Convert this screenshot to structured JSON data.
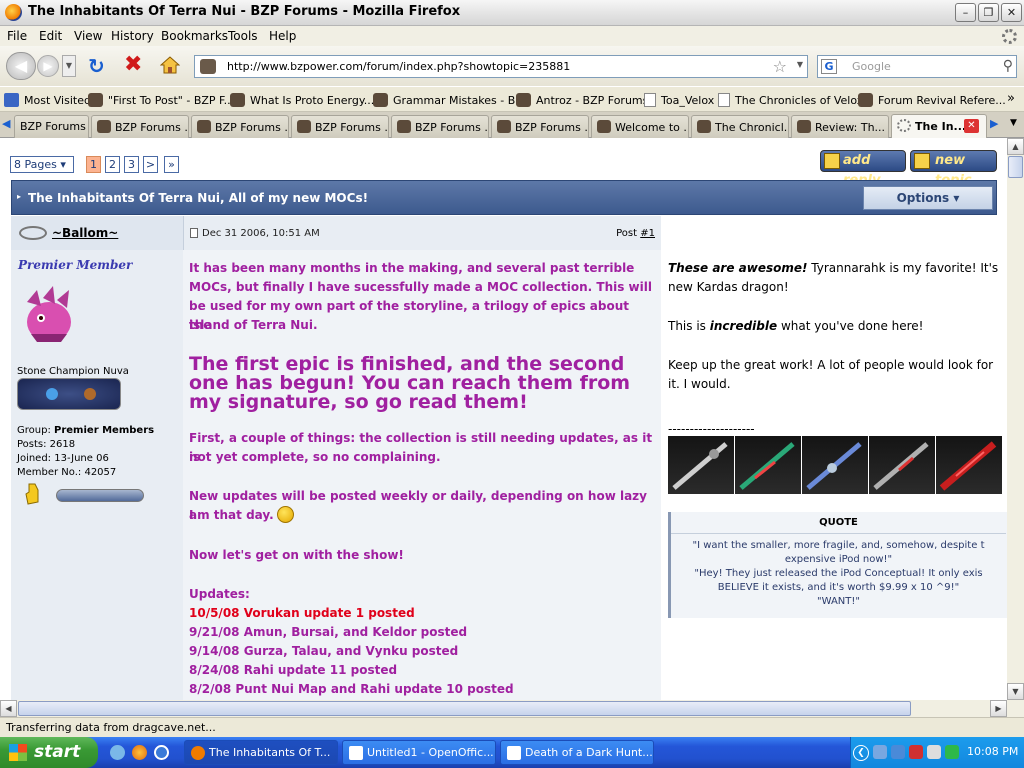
{
  "window": {
    "title": "The Inhabitants Of Terra Nui - BZP Forums - Mozilla Firefox"
  },
  "menu": [
    "File",
    "Edit",
    "View",
    "History",
    "Bookmarks",
    "Tools",
    "Help"
  ],
  "nav": {
    "url": "http://www.bzpower.com/forum/index.php?showtopic=235881",
    "search_placeholder": "Google"
  },
  "bookmarks": [
    "Most Visited",
    "\"First To Post\" - BZP F...",
    "What Is Proto Energy...",
    "Grammar Mistakes - B...",
    "Antroz - BZP Forums",
    "Toa_Velox",
    "The Chronicles of Velox",
    "Forum Revival Refere..."
  ],
  "tabs": [
    "BZP Forums ...",
    "BZP Forums ...",
    "BZP Forums ...",
    "BZP Forums ...",
    "BZP Forums ...",
    "BZP Forums ...",
    "Welcome to ...",
    "The Chronicl...",
    "Review: Th...",
    "The In..."
  ],
  "forum": {
    "pages_label": "8 Pages",
    "page_numbers": [
      "1",
      "2",
      "3",
      ">",
      "»"
    ],
    "add_reply": "add reply",
    "new_topic": "new topic",
    "topic_title": "The Inhabitants Of Terra Nui, All of my new MOCs!",
    "options": "Options ▾",
    "author": "~Ballom~",
    "post_date": "Dec 31 2006, 10:51 AM",
    "post_label": "Post",
    "post_num": "#1",
    "author_title": "Premier Member",
    "rank_title": "Stone Champion Nuva",
    "group_label": "Group:",
    "group_value": "Premier Members",
    "posts": "Posts: 2618",
    "joined": "Joined: 13-June 06",
    "member_no": "Member No.: 42057"
  },
  "post": {
    "p1": [
      "It has been many months in the making, and several past terrible",
      "MOCs, but finally I have sucessfully made a MOC collection. This will",
      "be used for my own part of the storyline, a trilogy of epics about the",
      "island of Terra Nui."
    ],
    "big": [
      "The first epic is finished, and the second",
      "one has begun! You can reach them from",
      "my signature, so go read them!"
    ],
    "p2": [
      "First, a couple of things: the collection is still needing updates, as it is",
      "not yet complete, so no complaining."
    ],
    "p3": [
      "New updates will be posted weekly or daily, depending on how lazy I",
      "am that day."
    ],
    "p4": "Now let's get on with the show!",
    "updates_label": "Updates:",
    "updates": [
      "10/5/08 Vorukan update 1 posted",
      "9/21/08 Amun, Bursai, and Keldor posted",
      "9/14/08 Gurza, Talau, and Vynku posted",
      "8/24/08 Rahi update 11 posted",
      "8/2/08 Punt Nui Map and Rahi update 10 posted"
    ]
  },
  "signature": {
    "line1_em": "These are awesome!",
    "line1_rest": " Tyrannarahk is my favorite! It's",
    "line2": "new Kardas dragon!",
    "line3_a": "This is ",
    "line3_em": "incredible",
    "line3_b": " what you've done here!",
    "line4": "Keep up the great work! A lot of people would look for",
    "line5": "it. I would.",
    "dashes": "--------------------",
    "quote_label": "QUOTE",
    "quote": [
      "\"I want the smaller, more fragile, and, somehow, despite t",
      "expensive iPod now!\"",
      "\"Hey! They just released the iPod Conceptual! It only exis",
      "BELIEVE it exists, and it's worth $9.99 x 10 ^9!\"",
      "\"WANT!\""
    ]
  },
  "status": "Transferring data from dragcave.net...",
  "taskbar": {
    "start": "start",
    "tasks": [
      "The Inhabitants Of T...",
      "Untitled1 - OpenOffic...",
      "Death of a Dark Hunt..."
    ],
    "clock": "10:08 PM"
  }
}
